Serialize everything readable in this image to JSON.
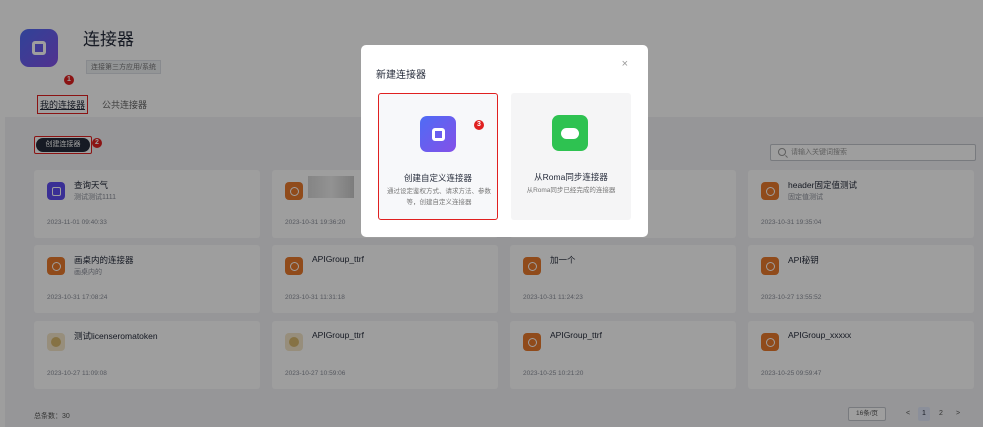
{
  "header": {
    "title": "连接器",
    "description": "连接第三方应用/系统"
  },
  "tabs": [
    {
      "label": "我的连接器"
    },
    {
      "label": "公共连接器"
    }
  ],
  "toolbar": {
    "create_label": "创建连接器"
  },
  "search": {
    "placeholder": "请输入关键词搜索"
  },
  "badges": [
    "1",
    "2",
    "3"
  ],
  "cards": [
    {
      "name": "查询天气",
      "desc": "测试测试1111",
      "time": "2023-11-01 09:40:33",
      "icon": "custom-connector-icon"
    },
    {
      "name": "",
      "desc": "",
      "time": "2023-10-31 19:36:20",
      "icon": "orange-connector-icon"
    },
    {
      "name": "",
      "desc": "",
      "time": "",
      "icon": ""
    },
    {
      "name": "header固定值测试",
      "desc": "固定值测试",
      "time": "2023-10-31 19:35:04",
      "icon": "orange-connector-icon"
    },
    {
      "name": "画桌内的连接器",
      "desc": "画桌内的",
      "time": "2023-10-31 17:08:24",
      "icon": "orange-connector-icon"
    },
    {
      "name": "APIGroup_ttrf",
      "desc": "",
      "time": "2023-10-31 11:31:18",
      "icon": "orange-connector-icon"
    },
    {
      "name": "加一个",
      "desc": "",
      "time": "2023-10-31 11:24:23",
      "icon": "orange-connector-icon"
    },
    {
      "name": "API秘钥",
      "desc": "",
      "time": "2023-10-27 13:55:52",
      "icon": "orange-connector-icon"
    },
    {
      "name": "测试licenseromatoken",
      "desc": "",
      "time": "2023-10-27 11:09:08",
      "icon": "image-icon"
    },
    {
      "name": "APIGroup_ttrf",
      "desc": "",
      "time": "2023-10-27 10:59:06",
      "icon": "image-icon"
    },
    {
      "name": "APIGroup_ttrf",
      "desc": "",
      "time": "2023-10-25 10:21:20",
      "icon": "orange-connector-icon"
    },
    {
      "name": "APIGroup_xxxxx",
      "desc": "",
      "time": "2023-10-25 09:59:47",
      "icon": "orange-connector-icon"
    }
  ],
  "footer": {
    "total": "总条数：30",
    "page_size": "16条/页",
    "prev": "<",
    "pages": [
      "1",
      "2"
    ],
    "next": ">"
  },
  "modal": {
    "title": "新建连接器",
    "close": "×",
    "custom": {
      "name": "创建自定义连接器",
      "desc": "通过设定鉴权方式、请求方法、参数等，创建自定义连接器"
    },
    "roma": {
      "name": "从Roma同步连接器",
      "desc": "从Roma同步已经完成的连接器"
    }
  },
  "colors": {
    "accent": "#e02020",
    "dark": "#252b3a",
    "purple": "#5e4cf0",
    "green": "#2ec251",
    "orange": "#e97a2d"
  }
}
